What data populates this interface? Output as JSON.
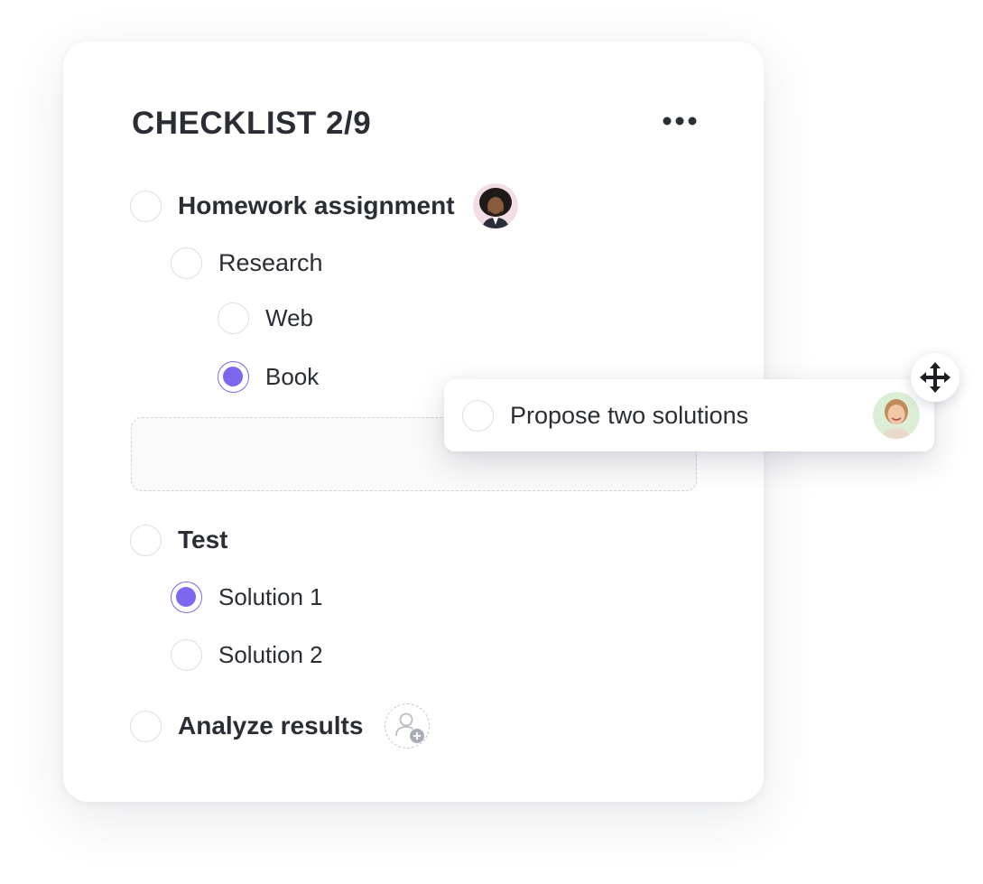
{
  "checklist": {
    "title": "CHECKLIST 2/9",
    "more_icon": "more-horizontal-icon",
    "items": [
      {
        "label": "Homework assignment",
        "checked": false,
        "level": 0,
        "assignee": "avatar-man-curly-hair"
      },
      {
        "label": "Research",
        "checked": false,
        "level": 1
      },
      {
        "label": "Web",
        "checked": false,
        "level": 2
      },
      {
        "label": "Book",
        "checked": true,
        "level": 2
      },
      {
        "label": "Test",
        "checked": false,
        "level": 0
      },
      {
        "label": "Solution 1",
        "checked": true,
        "level": 1
      },
      {
        "label": "Solution 2",
        "checked": false,
        "level": 1
      },
      {
        "label": "Analyze results",
        "checked": false,
        "level": 0,
        "assignee_icon": "add-user-icon"
      }
    ]
  },
  "dragging_item": {
    "label": "Propose two solutions",
    "checked": false,
    "assignee": "avatar-woman-smiling",
    "handle_icon": "move-arrows-icon"
  },
  "colors": {
    "accent": "#7b68ee",
    "text": "#2a2e34",
    "checkbox_border": "#dcdfe4"
  }
}
